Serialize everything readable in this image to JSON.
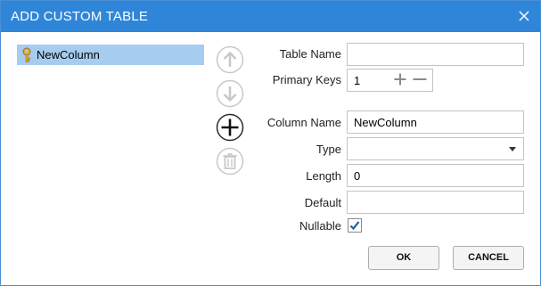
{
  "dialog": {
    "title": "ADD CUSTOM TABLE"
  },
  "columns_list": {
    "items": [
      {
        "label": "NewColumn",
        "icon": "key-icon"
      }
    ]
  },
  "side_actions": {
    "icons": [
      "arrow-up-icon",
      "arrow-down-icon",
      "plus-icon",
      "trash-icon"
    ]
  },
  "form": {
    "table_name_label": "Table Name",
    "table_name_value": "",
    "primary_keys_label": "Primary Keys",
    "primary_keys_value": "1",
    "column_name_label": "Column Name",
    "column_name_value": "NewColumn",
    "type_label": "Type",
    "type_value": "",
    "length_label": "Length",
    "length_value": "0",
    "default_label": "Default",
    "default_value": "",
    "nullable_label": "Nullable",
    "nullable_checked": true
  },
  "buttons": {
    "ok_label": "OK",
    "cancel_label": "CANCEL"
  },
  "colors": {
    "titlebar": "#2f86d8",
    "selection": "#a6cdf0",
    "check": "#1f5f9e"
  }
}
